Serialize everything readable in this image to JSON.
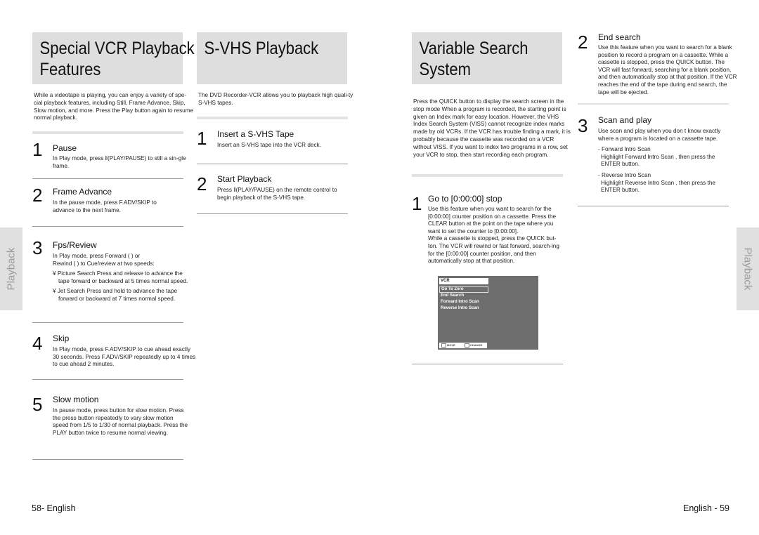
{
  "left_page": {
    "special_vcr": {
      "title_line1": "Special VCR Playback",
      "title_line2": "Features",
      "intro": "While a videotape is playing, you can enjoy a variety of spe-cial playback features, including Still, Frame Advance, Skip, Slow motion, and more. Press the Play button again to resume normal playback.",
      "steps": [
        {
          "num": "1",
          "title": "Pause",
          "body": "In Play mode, press  ‖(PLAY/PAUSE) to still a sin-gle frame."
        },
        {
          "num": "2",
          "title": "Frame Advance",
          "body": "In the pause mode, press F.ADV/SKIP to advance to the next frame."
        },
        {
          "num": "3",
          "title": "Fps/Review",
          "body_line1": "In Play mode, press Forward (   ) or",
          "body_line2": "Rewind (      ) to Cue/review at two speeds:",
          "bullets": [
            "¥ Picture Search   Press and release to advance the tape forward or backward at 5 times normal speed.",
            "¥ Jet Search   Press and hold to advance the tape forward or backward at 7 times normal speed."
          ]
        },
        {
          "num": "4",
          "title": "Skip",
          "body": "In Play mode, press F.ADV/SKIP to cue ahead exactly 30 seconds. Press F.ADV/SKIP repeatedly up to 4 times to cue ahead 2 minutes."
        },
        {
          "num": "5",
          "title": "Slow motion",
          "body": "In pause mode, press     button for slow motion. Press the press     button repeatedly to vary slow motion speed from 1/5 to 1/30 of normal playback. Press the PLAY button twice to resume normal viewing."
        }
      ]
    },
    "svhs": {
      "title": "S-VHS Playback",
      "intro": "The DVD Recorder-VCR allows you to playback high quali-ty S-VHS tapes.",
      "steps": [
        {
          "num": "1",
          "title": "Insert a S-VHS Tape",
          "body": "Insert an S-VHS tape into the VCR deck."
        },
        {
          "num": "2",
          "title": "Start Playback",
          "body": "Press   ‖(PLAY/PAUSE) on the remote control to begin playback of the S-VHS tape."
        }
      ]
    },
    "side_tab": "Playback",
    "page_number": "58- English"
  },
  "right_page": {
    "variable_search": {
      "title_line1": "Variable Search",
      "title_line2": "System",
      "intro": "Press the QUICK button to display the search screen in the stop mode When a program is recorded, the starting point is given an Index mark for easy location. However, the VHS Index Search System (VISS) cannot recognize index marks made by old VCRs. If the VCR has trouble finding a mark, it is probably because the cassette was recorded on a VCR without VISS. If you want to index two programs in a row, set your VCR to stop, then start recording each program.",
      "steps": [
        {
          "num": "1",
          "title": "Go to [0:00:00] stop",
          "body1": "Use this feature when you want to search for the [0:00:00] counter position on a cassette. Press the CLEAR button at the point on the tape where you want to set the counter to [0:00:00].",
          "body2": "While a cassette is stopped, press the QUICK but-ton. The VCR will rewind or fast forward, search-ing for the [0:00:00] counter position, and then automatically stop at that position."
        },
        {
          "num": "2",
          "title": "End search",
          "body": "Use this feature when you want to search for a blank position to record a program on a cassette. While a cassette is stopped, press the QUICK button. The VCR will fast forward, searching for a blank position, and then automatically stop at that position. If the VCR reaches the end of the tape during end search, the tape will be ejected."
        },
        {
          "num": "3",
          "title": "Scan and play",
          "body": "Use scan and play when you don t know exactly where a program is located on a cassette tape.",
          "subs": [
            {
              "head": "- Forward Intro Scan",
              "text": "Highlight  Forward Intro Scan , then press the ENTER button."
            },
            {
              "head": "- Reverse Intro Scan",
              "text": "Highlight  Reverse Intro Scan , then press the ENTER button."
            }
          ]
        }
      ]
    },
    "osd_menu": {
      "header": "VCR",
      "items": [
        "Go To Zero",
        "End Search",
        "Forward Intro Scan",
        "Reverse Intro Scan"
      ],
      "selected_index": 0,
      "footer_move": "MOVE",
      "footer_change": "CHANGE"
    },
    "side_tab": "Playback",
    "page_number": "English - 59"
  }
}
